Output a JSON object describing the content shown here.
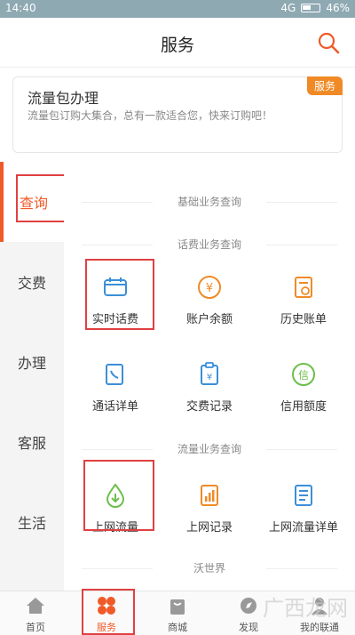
{
  "status_bar": {
    "time": "14:40",
    "network": "4G",
    "battery": "46%"
  },
  "header": {
    "title": "服务"
  },
  "banner": {
    "title": "流量包办理",
    "desc": "流量包订购大集合，总有一款适合您，快来订购吧！",
    "badge": "服务"
  },
  "left_nav": [
    {
      "label": "查询"
    },
    {
      "label": "交费"
    },
    {
      "label": "办理"
    },
    {
      "label": "客服"
    },
    {
      "label": "生活"
    }
  ],
  "sections": {
    "basic": "基础业务查询",
    "phone_fee": "话费业务查询",
    "data": "流量业务查询",
    "wo_world": "沃世界"
  },
  "phone_fee_items": [
    {
      "label": "实时话费",
      "icon": "wallet-icon"
    },
    {
      "label": "账户余额",
      "icon": "yen-icon"
    },
    {
      "label": "历史账单",
      "icon": "bill-icon"
    },
    {
      "label": "通话详单",
      "icon": "call-list-icon"
    },
    {
      "label": "交费记录",
      "icon": "payment-record-icon"
    },
    {
      "label": "信用额度",
      "icon": "credit-icon"
    }
  ],
  "data_items": [
    {
      "label": "上网流量",
      "icon": "data-drop-icon"
    },
    {
      "label": "上网记录",
      "icon": "data-record-icon"
    },
    {
      "label": "上网流量详单",
      "icon": "data-detail-icon"
    }
  ],
  "bottom_tabs": [
    {
      "label": "首页",
      "icon": "home-icon"
    },
    {
      "label": "服务",
      "icon": "service-icon"
    },
    {
      "label": "商城",
      "icon": "bag-icon"
    },
    {
      "label": "发现",
      "icon": "compass-icon"
    },
    {
      "label": "我的联通",
      "icon": "user-icon"
    }
  ],
  "watermark": "广西龙网",
  "colors": {
    "accent": "#f05a28",
    "orange": "#f08a26",
    "blue": "#3b8fd9",
    "green": "#6cbf4b"
  }
}
